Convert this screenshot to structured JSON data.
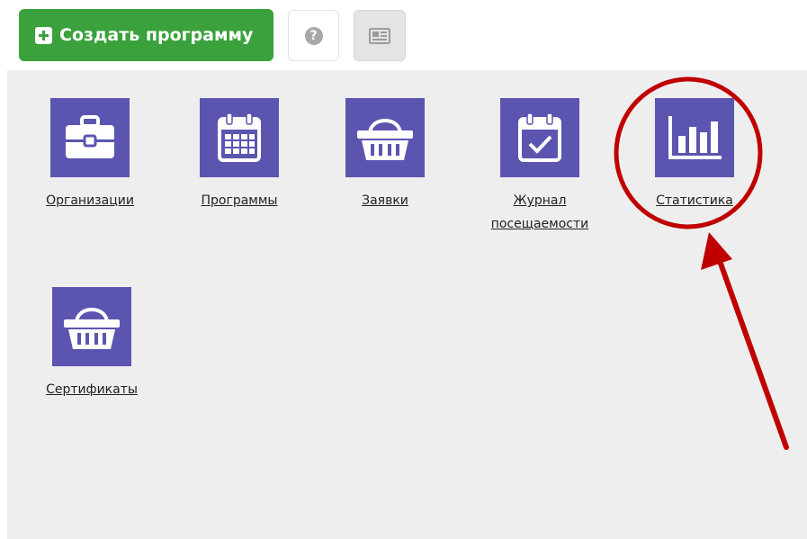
{
  "toolbar": {
    "create_label": "Создать программу",
    "help_glyph": "?"
  },
  "tiles": [
    {
      "label": "Организации",
      "icon": "briefcase-icon"
    },
    {
      "label": "Программы",
      "icon": "calendar-icon"
    },
    {
      "label": "Заявки",
      "icon": "basket-icon"
    },
    {
      "label": "Журнал посещаемости",
      "icon": "calendar-check-icon"
    },
    {
      "label": "Статистика",
      "icon": "bar-chart-icon"
    },
    {
      "label": "Сертификаты",
      "icon": "basket-icon"
    }
  ],
  "colors": {
    "create_button": "#3aa13d",
    "tile_icon_bg": "#5b55b0",
    "panel_bg": "#eeeeee",
    "annotation": "#c00000"
  }
}
